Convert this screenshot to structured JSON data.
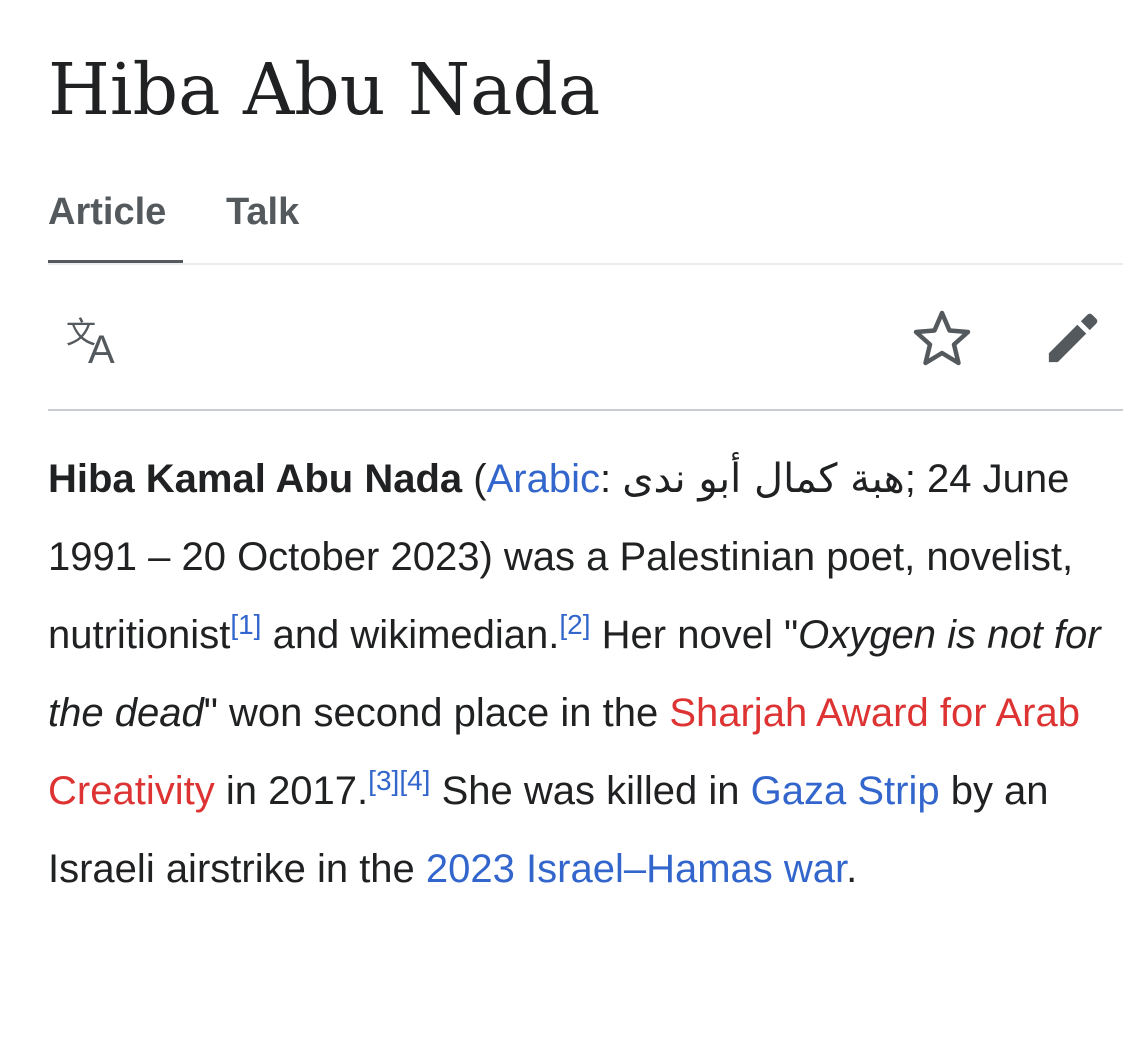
{
  "page": {
    "title": "Hiba Abu Nada"
  },
  "tabs": [
    {
      "label": "Article",
      "active": true
    },
    {
      "label": "Talk",
      "active": false
    }
  ],
  "toolbar": {
    "language_icon": "translate-icon",
    "watch_icon": "star-icon",
    "edit_icon": "pencil-icon"
  },
  "article": {
    "name_bold": "Hiba Kamal Abu Nada",
    "open_paren": " (",
    "arabic_link": "Arabic",
    "colon": ": ",
    "arabic_name": "هبة كمال أبو ندى",
    "after_arabic": "; 24 June 1991 – 20 October 2023) was a Palestinian poet, novelist, nutritionist",
    "ref1": "[1]",
    "and_wikimedian": " and wikimedian.",
    "ref2": "[2]",
    "her_novel": " Her novel \"",
    "novel_title_part1": "Oxygen is not for the dead",
    "after_novel": "\" won second place in the ",
    "award_link": "Sharjah Award for Arab Creativity",
    "in_2017": " in 2017.",
    "ref3": "[3]",
    "ref4": "[4]",
    "killed_in": " She was killed in ",
    "gaza_link": "Gaza Strip",
    "by_airstrike": " by an Israeli airstrike in the ",
    "war_link": "2023 Israel–Hamas war",
    "final_period": "."
  },
  "colors": {
    "link": "#3366cc",
    "redlink": "#dd3333",
    "text": "#202122",
    "tab_text": "#54595d",
    "divider": "#c8ccd1"
  }
}
